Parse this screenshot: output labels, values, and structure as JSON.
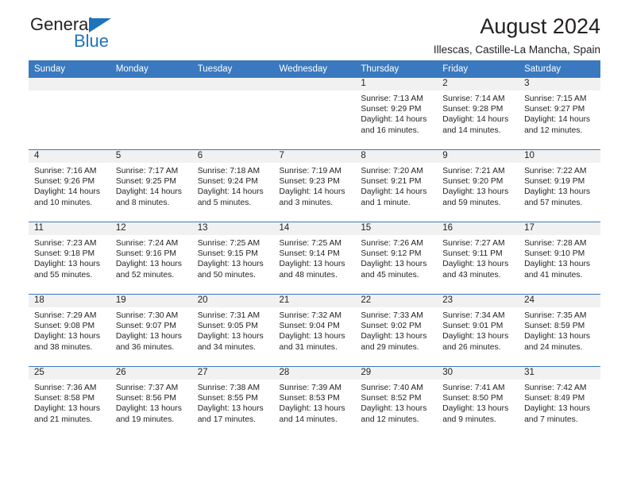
{
  "brand": {
    "name_part1": "General",
    "name_part2": "Blue",
    "accent_color": "#1c74bc"
  },
  "header": {
    "title": "August 2024",
    "subtitle": "Illescas, Castille-La Mancha, Spain"
  },
  "calendar": {
    "header_bg": "#3a79bf",
    "weekday_headers": [
      "Sunday",
      "Monday",
      "Tuesday",
      "Wednesday",
      "Thursday",
      "Friday",
      "Saturday"
    ],
    "labels": {
      "sunrise": "Sunrise:",
      "sunset": "Sunset:",
      "daylight": "Daylight:"
    },
    "weeks": [
      [
        {
          "day": "",
          "empty": true
        },
        {
          "day": "",
          "empty": true
        },
        {
          "day": "",
          "empty": true
        },
        {
          "day": "",
          "empty": true
        },
        {
          "day": "1",
          "sunrise": "Sunrise: 7:13 AM",
          "sunset": "Sunset: 9:29 PM",
          "daylight_1": "Daylight: 14 hours",
          "daylight_2": "and 16 minutes."
        },
        {
          "day": "2",
          "sunrise": "Sunrise: 7:14 AM",
          "sunset": "Sunset: 9:28 PM",
          "daylight_1": "Daylight: 14 hours",
          "daylight_2": "and 14 minutes."
        },
        {
          "day": "3",
          "sunrise": "Sunrise: 7:15 AM",
          "sunset": "Sunset: 9:27 PM",
          "daylight_1": "Daylight: 14 hours",
          "daylight_2": "and 12 minutes."
        }
      ],
      [
        {
          "day": "4",
          "sunrise": "Sunrise: 7:16 AM",
          "sunset": "Sunset: 9:26 PM",
          "daylight_1": "Daylight: 14 hours",
          "daylight_2": "and 10 minutes."
        },
        {
          "day": "5",
          "sunrise": "Sunrise: 7:17 AM",
          "sunset": "Sunset: 9:25 PM",
          "daylight_1": "Daylight: 14 hours",
          "daylight_2": "and 8 minutes."
        },
        {
          "day": "6",
          "sunrise": "Sunrise: 7:18 AM",
          "sunset": "Sunset: 9:24 PM",
          "daylight_1": "Daylight: 14 hours",
          "daylight_2": "and 5 minutes."
        },
        {
          "day": "7",
          "sunrise": "Sunrise: 7:19 AM",
          "sunset": "Sunset: 9:23 PM",
          "daylight_1": "Daylight: 14 hours",
          "daylight_2": "and 3 minutes."
        },
        {
          "day": "8",
          "sunrise": "Sunrise: 7:20 AM",
          "sunset": "Sunset: 9:21 PM",
          "daylight_1": "Daylight: 14 hours",
          "daylight_2": "and 1 minute."
        },
        {
          "day": "9",
          "sunrise": "Sunrise: 7:21 AM",
          "sunset": "Sunset: 9:20 PM",
          "daylight_1": "Daylight: 13 hours",
          "daylight_2": "and 59 minutes."
        },
        {
          "day": "10",
          "sunrise": "Sunrise: 7:22 AM",
          "sunset": "Sunset: 9:19 PM",
          "daylight_1": "Daylight: 13 hours",
          "daylight_2": "and 57 minutes."
        }
      ],
      [
        {
          "day": "11",
          "sunrise": "Sunrise: 7:23 AM",
          "sunset": "Sunset: 9:18 PM",
          "daylight_1": "Daylight: 13 hours",
          "daylight_2": "and 55 minutes."
        },
        {
          "day": "12",
          "sunrise": "Sunrise: 7:24 AM",
          "sunset": "Sunset: 9:16 PM",
          "daylight_1": "Daylight: 13 hours",
          "daylight_2": "and 52 minutes."
        },
        {
          "day": "13",
          "sunrise": "Sunrise: 7:25 AM",
          "sunset": "Sunset: 9:15 PM",
          "daylight_1": "Daylight: 13 hours",
          "daylight_2": "and 50 minutes."
        },
        {
          "day": "14",
          "sunrise": "Sunrise: 7:25 AM",
          "sunset": "Sunset: 9:14 PM",
          "daylight_1": "Daylight: 13 hours",
          "daylight_2": "and 48 minutes."
        },
        {
          "day": "15",
          "sunrise": "Sunrise: 7:26 AM",
          "sunset": "Sunset: 9:12 PM",
          "daylight_1": "Daylight: 13 hours",
          "daylight_2": "and 45 minutes."
        },
        {
          "day": "16",
          "sunrise": "Sunrise: 7:27 AM",
          "sunset": "Sunset: 9:11 PM",
          "daylight_1": "Daylight: 13 hours",
          "daylight_2": "and 43 minutes."
        },
        {
          "day": "17",
          "sunrise": "Sunrise: 7:28 AM",
          "sunset": "Sunset: 9:10 PM",
          "daylight_1": "Daylight: 13 hours",
          "daylight_2": "and 41 minutes."
        }
      ],
      [
        {
          "day": "18",
          "sunrise": "Sunrise: 7:29 AM",
          "sunset": "Sunset: 9:08 PM",
          "daylight_1": "Daylight: 13 hours",
          "daylight_2": "and 38 minutes."
        },
        {
          "day": "19",
          "sunrise": "Sunrise: 7:30 AM",
          "sunset": "Sunset: 9:07 PM",
          "daylight_1": "Daylight: 13 hours",
          "daylight_2": "and 36 minutes."
        },
        {
          "day": "20",
          "sunrise": "Sunrise: 7:31 AM",
          "sunset": "Sunset: 9:05 PM",
          "daylight_1": "Daylight: 13 hours",
          "daylight_2": "and 34 minutes."
        },
        {
          "day": "21",
          "sunrise": "Sunrise: 7:32 AM",
          "sunset": "Sunset: 9:04 PM",
          "daylight_1": "Daylight: 13 hours",
          "daylight_2": "and 31 minutes."
        },
        {
          "day": "22",
          "sunrise": "Sunrise: 7:33 AM",
          "sunset": "Sunset: 9:02 PM",
          "daylight_1": "Daylight: 13 hours",
          "daylight_2": "and 29 minutes."
        },
        {
          "day": "23",
          "sunrise": "Sunrise: 7:34 AM",
          "sunset": "Sunset: 9:01 PM",
          "daylight_1": "Daylight: 13 hours",
          "daylight_2": "and 26 minutes."
        },
        {
          "day": "24",
          "sunrise": "Sunrise: 7:35 AM",
          "sunset": "Sunset: 8:59 PM",
          "daylight_1": "Daylight: 13 hours",
          "daylight_2": "and 24 minutes."
        }
      ],
      [
        {
          "day": "25",
          "sunrise": "Sunrise: 7:36 AM",
          "sunset": "Sunset: 8:58 PM",
          "daylight_1": "Daylight: 13 hours",
          "daylight_2": "and 21 minutes."
        },
        {
          "day": "26",
          "sunrise": "Sunrise: 7:37 AM",
          "sunset": "Sunset: 8:56 PM",
          "daylight_1": "Daylight: 13 hours",
          "daylight_2": "and 19 minutes."
        },
        {
          "day": "27",
          "sunrise": "Sunrise: 7:38 AM",
          "sunset": "Sunset: 8:55 PM",
          "daylight_1": "Daylight: 13 hours",
          "daylight_2": "and 17 minutes."
        },
        {
          "day": "28",
          "sunrise": "Sunrise: 7:39 AM",
          "sunset": "Sunset: 8:53 PM",
          "daylight_1": "Daylight: 13 hours",
          "daylight_2": "and 14 minutes."
        },
        {
          "day": "29",
          "sunrise": "Sunrise: 7:40 AM",
          "sunset": "Sunset: 8:52 PM",
          "daylight_1": "Daylight: 13 hours",
          "daylight_2": "and 12 minutes."
        },
        {
          "day": "30",
          "sunrise": "Sunrise: 7:41 AM",
          "sunset": "Sunset: 8:50 PM",
          "daylight_1": "Daylight: 13 hours",
          "daylight_2": "and 9 minutes."
        },
        {
          "day": "31",
          "sunrise": "Sunrise: 7:42 AM",
          "sunset": "Sunset: 8:49 PM",
          "daylight_1": "Daylight: 13 hours",
          "daylight_2": "and 7 minutes."
        }
      ]
    ]
  }
}
